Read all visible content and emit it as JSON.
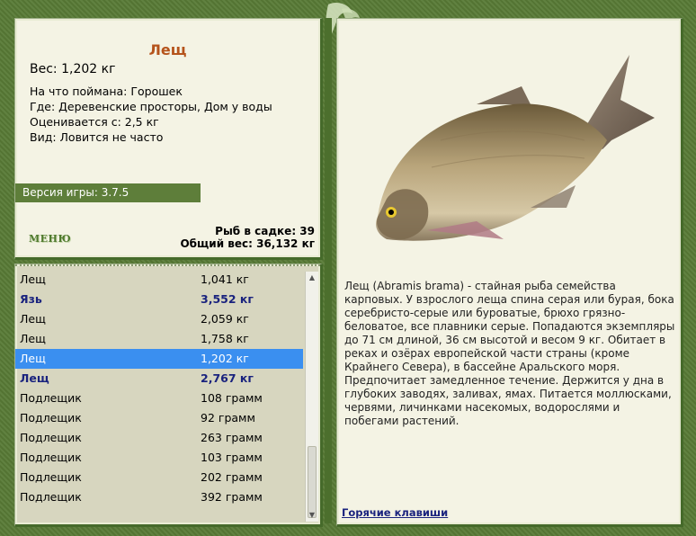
{
  "fish": {
    "name": "Лещ",
    "weight": "Вес: 1,202 кг",
    "caught_on": "На что поймана: Горошек",
    "location": "Где: Деревенские просторы, Дом у воды",
    "valued": "Оценивается с: 2,5 кг",
    "type": "Вид: Ловится не часто"
  },
  "version": "Версия игры: 3.7.5",
  "menu_label": "МЕНЮ",
  "stats": {
    "fish_count": "Рыб в садке: 39",
    "total_weight": "Общий вес: 36,132 кг"
  },
  "catch_list": [
    {
      "name": "Лещ",
      "weight": "1,041 кг",
      "bold": false
    },
    {
      "name": "Язь",
      "weight": "3,552 кг",
      "bold": true
    },
    {
      "name": "Лещ",
      "weight": "2,059 кг",
      "bold": false
    },
    {
      "name": "Лещ",
      "weight": "1,758 кг",
      "bold": false
    },
    {
      "name": "Лещ",
      "weight": "1,202 кг",
      "bold": false,
      "selected": true
    },
    {
      "name": "Лещ",
      "weight": "2,767 кг",
      "bold": true
    },
    {
      "name": "Подлещик",
      "weight": "108 грамм",
      "bold": false
    },
    {
      "name": "Подлещик",
      "weight": "92 грамм",
      "bold": false
    },
    {
      "name": "Подлещик",
      "weight": "263 грамм",
      "bold": false
    },
    {
      "name": "Подлещик",
      "weight": "103 грамм",
      "bold": false
    },
    {
      "name": "Подлещик",
      "weight": "202 грамм",
      "bold": false
    },
    {
      "name": "Подлещик",
      "weight": "392 грамм",
      "bold": false
    }
  ],
  "description": "Лещ (Abramis brama) - стайная рыба семейства карповых. У взрослого леща спина серая или бурая, бока серебристо-серые или буроватые, брюхо грязно-беловатое, все плавники серые. Попадаются экземпляры до 71 см длиной, 36 см высотой и весом 9 кг. Обитает в реках и озёрах европейской части страны (кроме Крайнего Севера), в бассейне Аральского моря. Предпочитает замедленное течение. Держится у дна в глубоких заводях, заливах, ямах. Питается моллюсками, червями, личинками насекомых, водорослями и побегами растений.",
  "hotkeys_label": "Горячие клавиши",
  "colors": {
    "frame": "#587a36",
    "panel": "#f4f3e4",
    "title": "#b5531b",
    "selected": "#3a8ff0",
    "bold_row": "#1a237e"
  }
}
